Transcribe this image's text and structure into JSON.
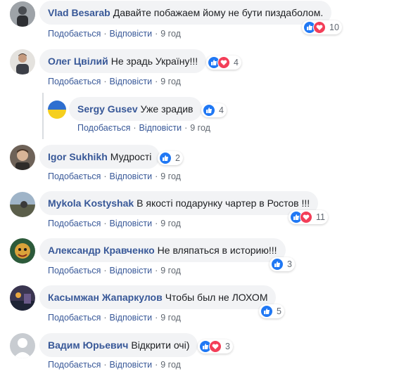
{
  "labels": {
    "like": "Подобається",
    "reply": "Відповісти",
    "sep": "·"
  },
  "comments": [
    {
      "author": "Vlad Besarab",
      "text": "Давайте побажаем йому не бути пиздаболом.",
      "time": "9 год",
      "reactions": [
        "like",
        "love"
      ],
      "count": "10"
    },
    {
      "author": "Олег Цвілий",
      "text": "Не зрадь Україну!!!",
      "time": "9 год",
      "reactions": [
        "like",
        "love"
      ],
      "count": "4"
    },
    {
      "author": "Sergy Gusev",
      "text": "Уже зрадив",
      "time": "9 год",
      "reactions": [
        "like"
      ],
      "count": "4"
    },
    {
      "author": "Igor Sukhikh",
      "text": "Мудрості",
      "time": "9 год",
      "reactions": [
        "like"
      ],
      "count": "2"
    },
    {
      "author": "Mykola Kostyshak",
      "text": "В якості подарунку чартер в Ростов !!!",
      "time": "9 год",
      "reactions": [
        "like",
        "love"
      ],
      "count": "11"
    },
    {
      "author": "Александр Кравченко",
      "text": "Не вляпаться в историю!!!",
      "time": "9 год",
      "reactions": [
        "like"
      ],
      "count": "3"
    },
    {
      "author": "Касымжан Жапаркулов",
      "text": "Чтобы был не ЛОХОМ",
      "time": "9 год",
      "reactions": [
        "like"
      ],
      "count": "5"
    },
    {
      "author": "Вадим Юрьевич",
      "text": "Відкрити очі)",
      "time": "9 год",
      "reactions": [
        "like",
        "love"
      ],
      "count": "3"
    }
  ],
  "colors": {
    "link": "#385898",
    "bubble": "#f2f3f5",
    "like": "#2078f4",
    "love": "#f33e58"
  }
}
